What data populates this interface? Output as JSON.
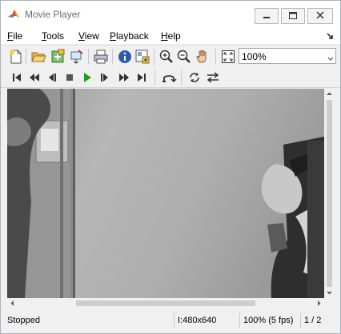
{
  "window": {
    "title": "Movie Player"
  },
  "menu": {
    "items": [
      {
        "label": "File",
        "ul": "F",
        "rest": "ile"
      },
      {
        "label": "Tools",
        "ul": "T",
        "rest": "ools"
      },
      {
        "label": "View",
        "ul": "V",
        "rest": "iew"
      },
      {
        "label": "Playback",
        "ul": "P",
        "rest": "layback"
      },
      {
        "label": "Help",
        "ul": "H",
        "rest": "elp"
      }
    ]
  },
  "toolbar": {
    "zoom_value": "100%"
  },
  "status": {
    "state": "Stopped",
    "video_format": "I:480x640",
    "frame_rate": "100% (5 fps)",
    "frame_counter": "1 / 2"
  },
  "colors": {
    "play_green": "#1aa31a",
    "hand_skin": "#f2c9a0"
  },
  "icons": [
    "matlab-icon",
    "minimize-icon",
    "maximize-icon",
    "close-icon",
    "dock-arrow-icon",
    "new-file-icon",
    "open-folder-icon",
    "connect-icon",
    "export-icon",
    "print-icon",
    "info-icon",
    "properties-icon",
    "zoom-in-icon",
    "zoom-out-icon",
    "pan-hand-icon",
    "fit-to-window-icon",
    "go-to-start-icon",
    "rewind-icon",
    "step-back-icon",
    "stop-icon",
    "play-icon",
    "step-forward-icon",
    "fast-forward-icon",
    "go-to-end-icon",
    "jump-to-icon",
    "loop-icon",
    "playback-direction-icon"
  ]
}
